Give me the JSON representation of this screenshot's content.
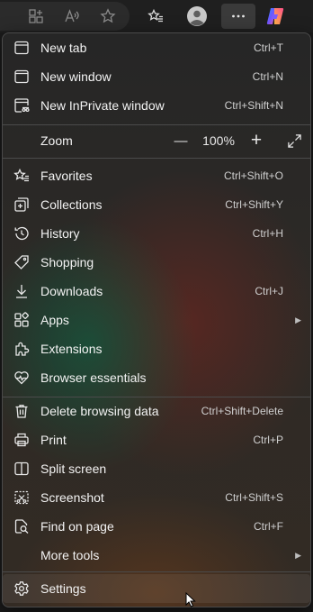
{
  "toolbar": {
    "icons": [
      "add-to-app-icon",
      "read-aloud-icon",
      "add-favorite-icon",
      "favorites-bar-icon",
      "profile-avatar-icon",
      "more-options-icon",
      "copilot-icon"
    ]
  },
  "menu": {
    "items": [
      {
        "label": "New tab",
        "shortcut": "Ctrl+T",
        "icon": "new-tab-icon"
      },
      {
        "label": "New window",
        "shortcut": "Ctrl+N",
        "icon": "new-window-icon"
      },
      {
        "label": "New InPrivate window",
        "shortcut": "Ctrl+Shift+N",
        "icon": "inprivate-icon"
      },
      {
        "label": "Favorites",
        "shortcut": "Ctrl+Shift+O",
        "icon": "favorites-icon"
      },
      {
        "label": "Collections",
        "shortcut": "Ctrl+Shift+Y",
        "icon": "collections-icon"
      },
      {
        "label": "History",
        "shortcut": "Ctrl+H",
        "icon": "history-icon"
      },
      {
        "label": "Shopping",
        "shortcut": "",
        "icon": "shopping-tag-icon"
      },
      {
        "label": "Downloads",
        "shortcut": "Ctrl+J",
        "icon": "downloads-icon"
      },
      {
        "label": "Apps",
        "shortcut": "",
        "icon": "apps-icon"
      },
      {
        "label": "Extensions",
        "shortcut": "",
        "icon": "extensions-icon"
      },
      {
        "label": "Browser essentials",
        "shortcut": "",
        "icon": "browser-essentials-icon"
      },
      {
        "label": "Delete browsing data",
        "shortcut": "Ctrl+Shift+Delete",
        "icon": "trash-icon"
      },
      {
        "label": "Print",
        "shortcut": "Ctrl+P",
        "icon": "print-icon"
      },
      {
        "label": "Split screen",
        "shortcut": "",
        "icon": "split-screen-icon"
      },
      {
        "label": "Screenshot",
        "shortcut": "Ctrl+Shift+S",
        "icon": "screenshot-icon"
      },
      {
        "label": "Find on page",
        "shortcut": "Ctrl+F",
        "icon": "find-icon"
      },
      {
        "label": "More tools",
        "shortcut": "",
        "icon": ""
      },
      {
        "label": "Settings",
        "shortcut": "",
        "icon": "settings-gear-icon"
      }
    ],
    "zoom": {
      "label": "Zoom",
      "minus": "—",
      "value": "100%",
      "plus": "+"
    },
    "submenu_indicator": "▶"
  }
}
